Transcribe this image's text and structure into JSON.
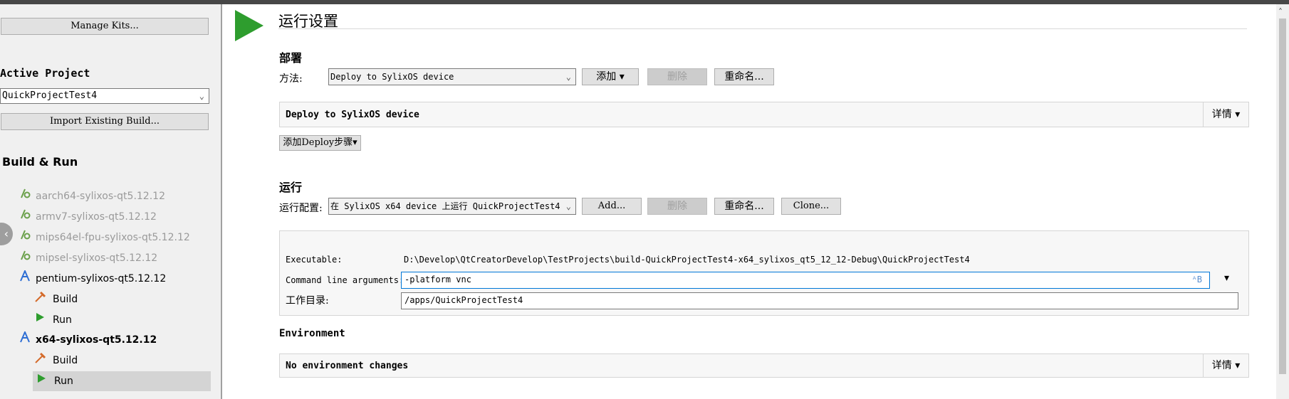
{
  "sidebar": {
    "manage_kits": "Manage Kits...",
    "active_project_label": "Active Project",
    "active_project_value": "QuickProjectTest4",
    "import_build": "Import Existing Build...",
    "build_run_title": "Build & Run",
    "kits": [
      {
        "label": "aarch64-sylixos-qt5.12.12",
        "enabled": false
      },
      {
        "label": "armv7-sylixos-qt5.12.12",
        "enabled": false
      },
      {
        "label": "mips64el-fpu-sylixos-qt5.12.12",
        "enabled": false
      },
      {
        "label": "mipsel-sylixos-qt5.12.12",
        "enabled": false
      },
      {
        "label": "pentium-sylixos-qt5.12.12",
        "enabled": true
      },
      {
        "label": "x64-sylixos-qt5.12.12",
        "enabled": true,
        "bold": true
      }
    ],
    "pentium_build": "Build",
    "pentium_run": "Run",
    "x64_build": "Build",
    "x64_run": "Run"
  },
  "main": {
    "title": "运行设置",
    "deploy": {
      "section": "部署",
      "method_label": "方法:",
      "method_value": "Deploy to SylixOS device",
      "add_label": "添加",
      "remove_label": "删除",
      "rename_label": "重命名...",
      "panel_text": "Deploy to SylixOS device",
      "details_label": "详情",
      "add_step_label": "添加Deploy步骤"
    },
    "run": {
      "section": "运行",
      "config_label": "运行配置:",
      "config_value": "在 SylixOS x64 device 上运行 QuickProjectTest4",
      "add_label": "Add...",
      "remove_label": "删除",
      "rename_label": "重命名...",
      "clone_label": "Clone...",
      "executable_label": "Executable:",
      "executable_value": "D:\\Develop\\QtCreatorDevelop\\TestProjects\\build-QuickProjectTest4-x64_sylixos_qt5_12_12-Debug\\QuickProjectTest4",
      "args_label": "Command line arguments:",
      "args_value": "-platform vnc",
      "workdir_label": "工作目录:",
      "workdir_value": "/apps/QuickProjectTest4"
    },
    "environment": {
      "section": "Environment",
      "panel_text": "No environment changes",
      "details_label": "详情"
    }
  }
}
